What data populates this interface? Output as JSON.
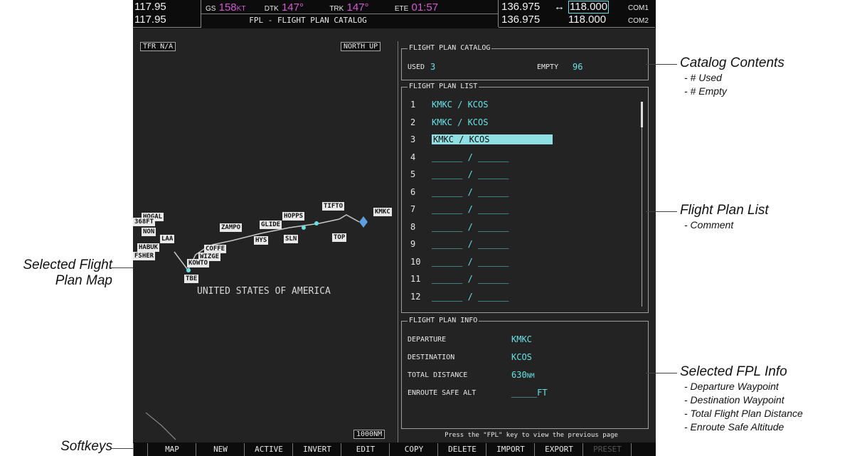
{
  "header": {
    "nav_freq_active": "117.95",
    "nav_freq_standby": "117.95",
    "gs_label": "GS",
    "gs_value": "158",
    "gs_unit": "KT",
    "dtk_label": "DTK",
    "dtk_value": "147°",
    "trk_label": "TRK",
    "trk_value": "147°",
    "ete_label": "ETE",
    "ete_value": "01:57",
    "page_title": "FPL - FLIGHT PLAN CATALOG",
    "com1_standby": "136.975",
    "com1_arrow": "↔",
    "com1_active": "118.000",
    "com1_label": "COM1",
    "com2_standby": "136.975",
    "com2_active": "118.000",
    "com2_label": "COM2"
  },
  "map": {
    "tfr": "TFR N/A",
    "orientation": "NORTH UP",
    "range": "1000NM",
    "country": "UNITED STATES OF AMERICA",
    "waypoints": {
      "hogal": "HOGAL",
      "b68ft": "368FT",
      "non": "NON",
      "laa": "LAA",
      "habuk": "HABUK",
      "fshen": "FSHER",
      "zampo": "ZAMPO",
      "glide": "GLIDE",
      "hopps": "HOPPS",
      "tifto": "TIFTO",
      "kmkc": "KMKC",
      "hys": "HYS",
      "sln": "SLN",
      "top": "TOP",
      "coffe": "COFFE",
      "wizge": "WIZGE",
      "kowto": "KOWTO",
      "tbe": "TBE"
    }
  },
  "catalog": {
    "title": "FLIGHT PLAN CATALOG",
    "used_label": "USED",
    "used_value": "3",
    "empty_label": "EMPTY",
    "empty_value": "96"
  },
  "list": {
    "title": "FLIGHT PLAN LIST",
    "rows": [
      {
        "num": "1",
        "text": "KMKC / KCOS"
      },
      {
        "num": "2",
        "text": "KMKC / KCOS"
      },
      {
        "num": "3",
        "text": "KMKC / KCOS"
      },
      {
        "num": "4",
        "text": "______ / ______"
      },
      {
        "num": "5",
        "text": "______ / ______"
      },
      {
        "num": "6",
        "text": "______ / ______"
      },
      {
        "num": "7",
        "text": "______ / ______"
      },
      {
        "num": "8",
        "text": "______ / ______"
      },
      {
        "num": "9",
        "text": "______ / ______"
      },
      {
        "num": "10",
        "text": "______ / ______"
      },
      {
        "num": "11",
        "text": "______ / ______"
      },
      {
        "num": "12",
        "text": "______ / ______"
      }
    ]
  },
  "info": {
    "title": "FLIGHT PLAN INFO",
    "departure_label": "DEPARTURE",
    "departure_value": "KMKC",
    "destination_label": "DESTINATION",
    "destination_value": "KCOS",
    "distance_label": "TOTAL DISTANCE",
    "distance_value": "630",
    "distance_unit": "NM",
    "esa_label": "ENROUTE SAFE ALT",
    "esa_value": "_____FT"
  },
  "prompt": "Press the \"FPL\" key to view the previous page",
  "softkeys": [
    "",
    "MAP",
    "NEW",
    "ACTIVE",
    "INVERT",
    "EDIT",
    "COPY",
    "DELETE",
    "IMPORT",
    "EXPORT",
    "PRESET",
    ""
  ],
  "callouts": {
    "catalog_title": "Catalog Contents",
    "catalog_items": [
      "- # Used",
      "- # Empty"
    ],
    "list_title": "Flight Plan List",
    "list_items": [
      "- Comment"
    ],
    "info_title": "Selected FPL Info",
    "info_items": [
      "- Departure Waypoint",
      "- Destination Waypoint",
      "- Total Flight Plan Distance",
      "- Enroute Safe Altitude"
    ],
    "map_title_1": "Selected Flight",
    "map_title_2": "Plan Map",
    "softkeys_title": "Softkeys"
  }
}
